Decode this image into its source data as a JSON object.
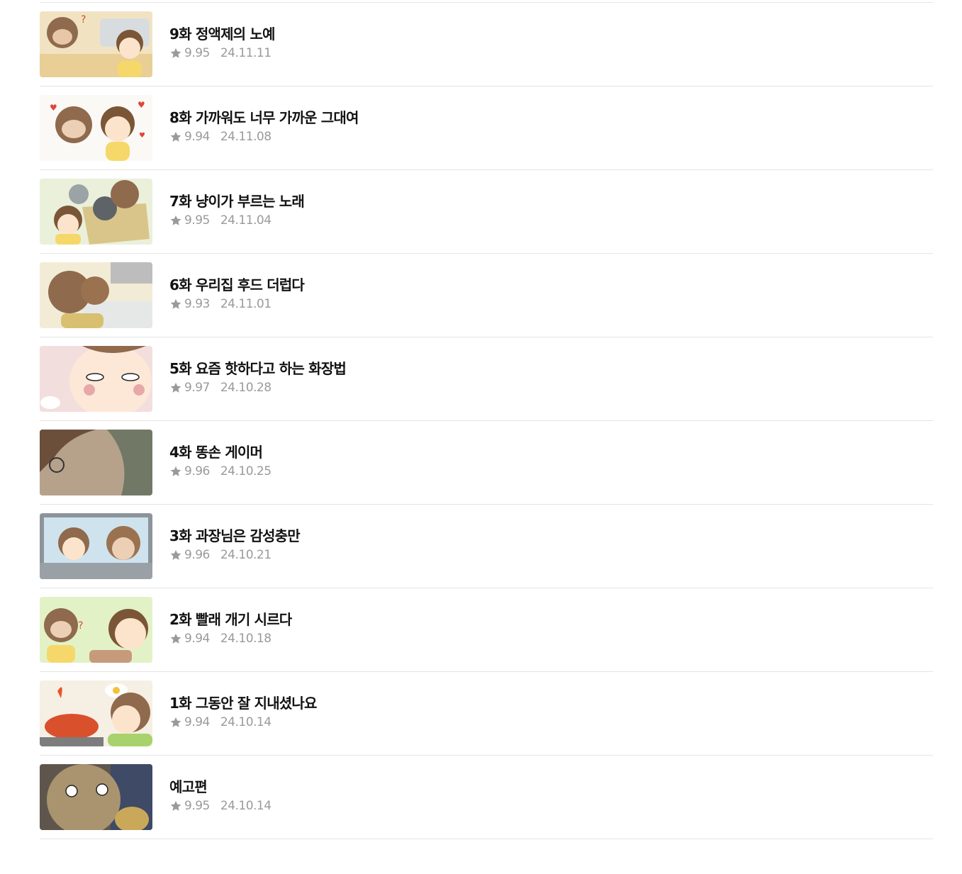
{
  "episodes": [
    {
      "title": "9화 정액제의 노예",
      "rating": "9.95",
      "date": "24.11.11",
      "thumb_bg": "#f1e3c2",
      "thumb_accent": "#8f6a4c"
    },
    {
      "title": "8화 가까워도 너무 가까운 그대여",
      "rating": "9.94",
      "date": "24.11.08",
      "thumb_bg": "#fbf9f6",
      "thumb_accent": "#8f6a4c"
    },
    {
      "title": "7화 냥이가 부르는 노래",
      "rating": "9.95",
      "date": "24.11.04",
      "thumb_bg": "#eaf0da",
      "thumb_accent": "#6d7378"
    },
    {
      "title": "6화 우리집 후드 더럽다",
      "rating": "9.93",
      "date": "24.11.01",
      "thumb_bg": "#f2ecd6",
      "thumb_accent": "#9a7250"
    },
    {
      "title": "5화 요즘 핫하다고 하는 화장법",
      "rating": "9.97",
      "date": "24.10.28",
      "thumb_bg": "#f3dede",
      "thumb_accent": "#e7a8a8"
    },
    {
      "title": "4화 똥손 게이머",
      "rating": "9.96",
      "date": "24.10.25",
      "thumb_bg": "#717866",
      "thumb_accent": "#b6a18b"
    },
    {
      "title": "3화 과장님은 감성충만",
      "rating": "9.96",
      "date": "24.10.21",
      "thumb_bg": "#cfe3ee",
      "thumb_accent": "#8f6a4c"
    },
    {
      "title": "2화 빨래 개기 시르다",
      "rating": "9.94",
      "date": "24.10.18",
      "thumb_bg": "#e3f1c6",
      "thumb_accent": "#8f6a4c"
    },
    {
      "title": "1화 그동안 잘 지내셨나요",
      "rating": "9.94",
      "date": "24.10.14",
      "thumb_bg": "#f6efe4",
      "thumb_accent": "#d9502d"
    },
    {
      "title": "예고편",
      "rating": "9.95",
      "date": "24.10.14",
      "thumb_bg": "#5e564c",
      "thumb_accent": "#a9946f"
    }
  ]
}
